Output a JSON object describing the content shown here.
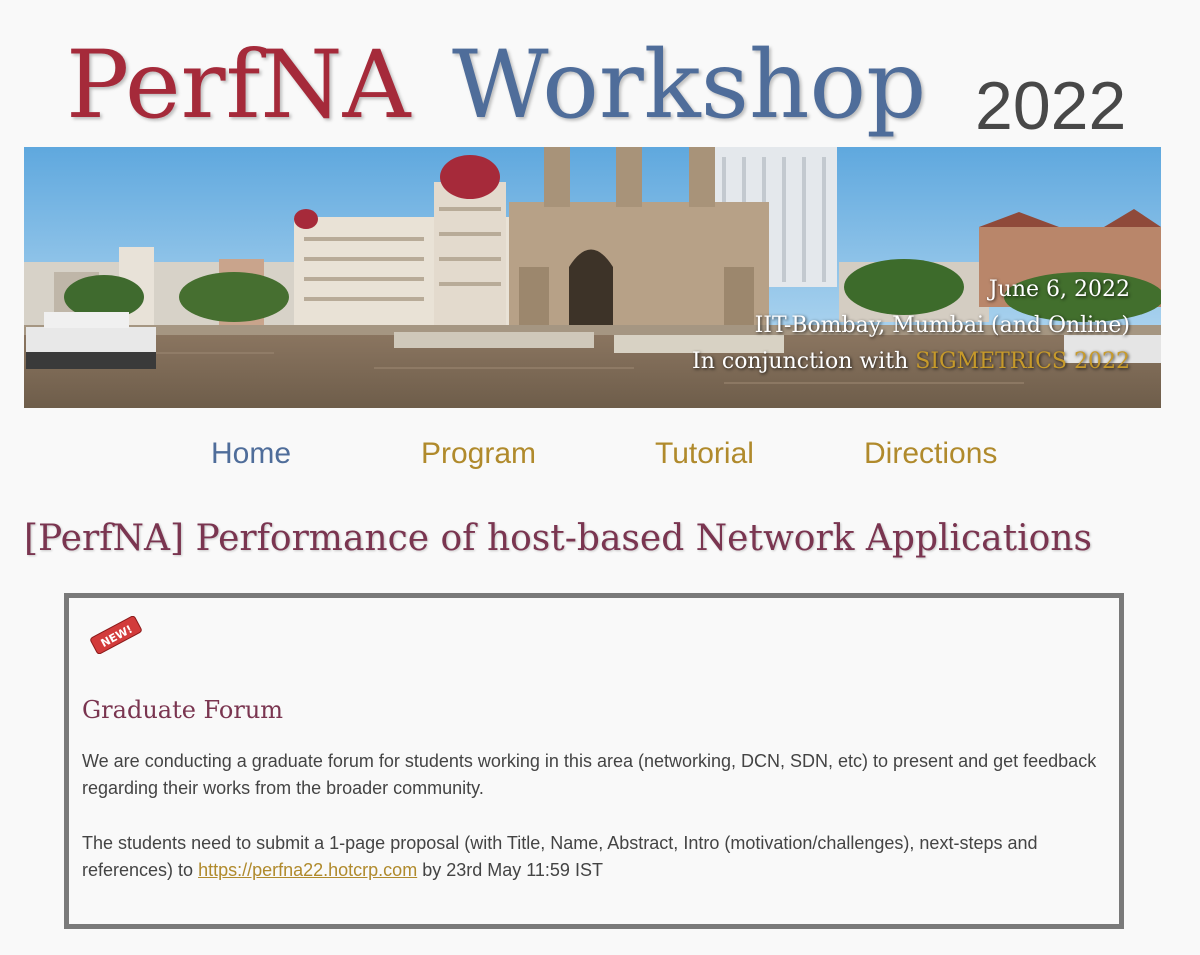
{
  "header": {
    "title_part1": "PerfNA",
    "title_part2": "Workshop",
    "year": "2022"
  },
  "banner": {
    "date": "June 6, 2022",
    "location": "IIT-Bombay, Mumbai (and Online)",
    "conjunction_prefix": "In conjunction with ",
    "conjunction_link": "SIGMETRICS 2022"
  },
  "nav": {
    "items": [
      {
        "label": "Home",
        "active": true
      },
      {
        "label": "Program",
        "active": false
      },
      {
        "label": "Tutorial",
        "active": false
      },
      {
        "label": "Directions",
        "active": false
      }
    ]
  },
  "main": {
    "heading": "[PerfNA] Performance of host-based Network Applications",
    "announcement": {
      "badge": "NEW!",
      "title": "Graduate Forum",
      "paragraph1": "We are conducting a graduate forum for students working in this area (networking, DCN, SDN, etc) to present and get feedback regarding their works from the broader community.",
      "paragraph2_prefix": "The students need to submit a 1-page proposal (with Title, Name, Abstract, Intro (motivation/challenges), next-steps and references) to ",
      "paragraph2_link": "https://perfna22.hotcrp.com",
      "paragraph2_suffix": " by 23rd May 11:59 IST"
    }
  },
  "colors": {
    "title_red": "#a52a3a",
    "title_blue": "#4f6d9a",
    "link_gold": "#b08a2c",
    "heading_maroon": "#7a3550"
  },
  "icons": {
    "banner_image": "mumbai-gateway-photo",
    "badge": "new-badge-icon"
  }
}
